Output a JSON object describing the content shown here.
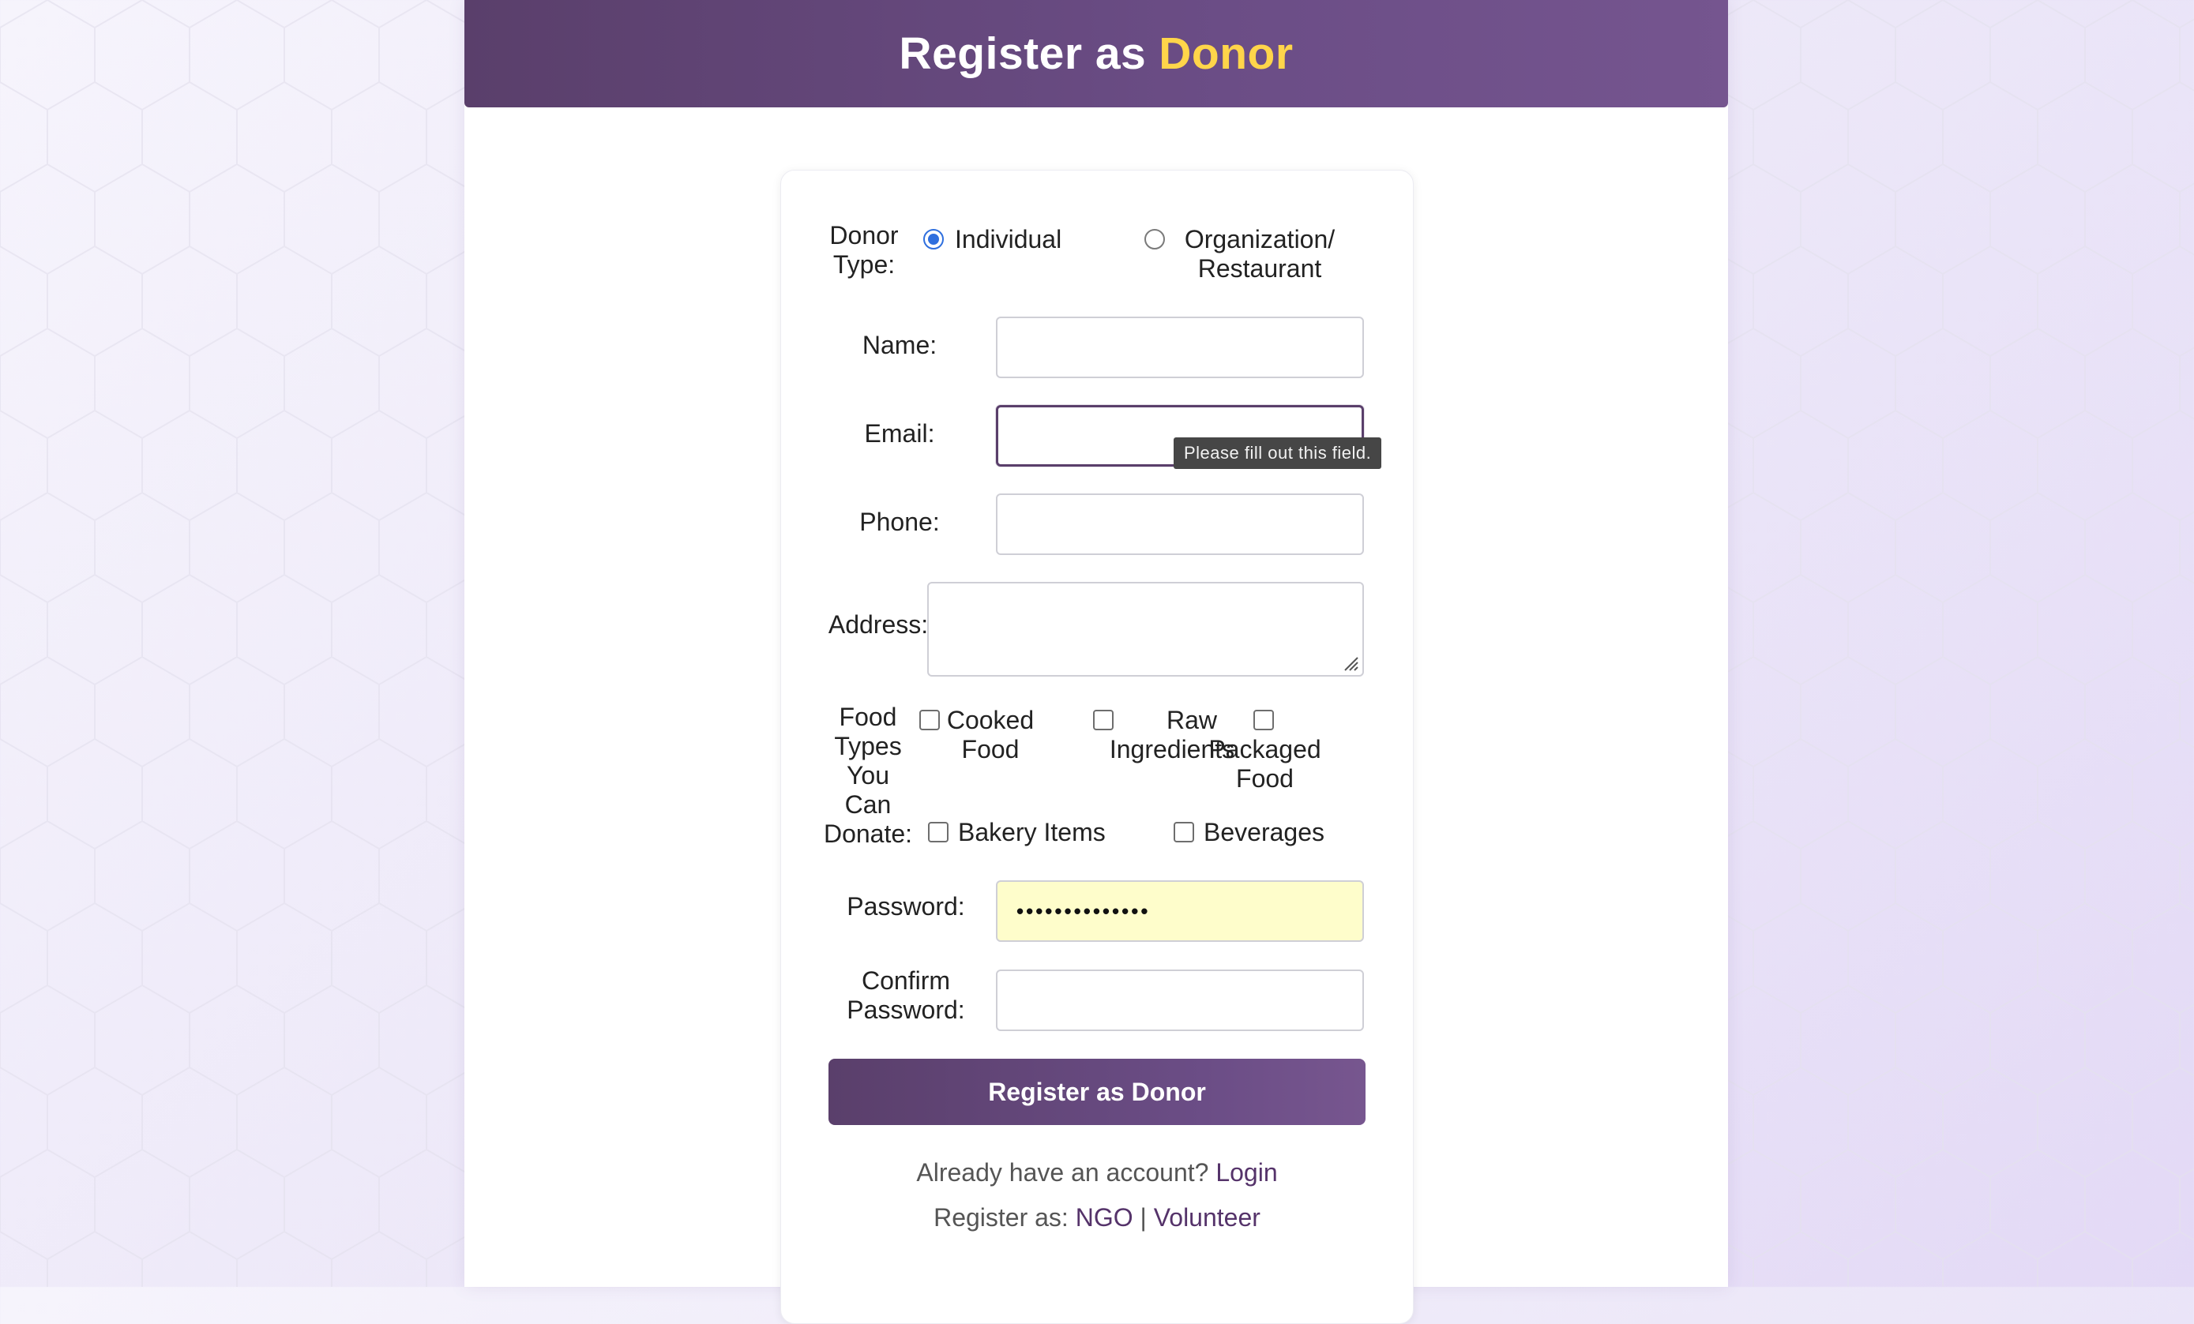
{
  "header": {
    "title_prefix": "Register as",
    "title_accent": "Donor",
    "accent_color": "#ffd54a",
    "brand_color": "#5a3f6b"
  },
  "form": {
    "donor_type": {
      "label_line1": "Donor",
      "label_line2": "Type:",
      "options": [
        {
          "line1": "Individual",
          "line2": "",
          "checked": true
        },
        {
          "line1": "Organization/",
          "line2": "Restaurant",
          "checked": false
        }
      ]
    },
    "name": {
      "label": "Name:",
      "value": ""
    },
    "email": {
      "label": "Email:",
      "value": "",
      "validation_tooltip": "Please fill out this field."
    },
    "phone": {
      "label": "Phone:",
      "value": ""
    },
    "address": {
      "label": "Address:",
      "value": ""
    },
    "food_types": {
      "label_lines": [
        "Food",
        "Types",
        "You",
        "Can",
        "Donate:"
      ],
      "options": [
        {
          "line1": "Cooked",
          "line2": "Food",
          "checked": false
        },
        {
          "line1": "Raw",
          "line2": "Ingredients",
          "checked": false
        },
        {
          "line1": "",
          "line2": "Packaged",
          "line3": "Food",
          "checked": false
        },
        {
          "line1": "Bakery Items",
          "checked": false
        },
        {
          "line1": "Beverages",
          "checked": false
        }
      ]
    },
    "password": {
      "label": "Password:",
      "masked_value": "••••••••••••••"
    },
    "confirm_password": {
      "label_line1": "Confirm",
      "label_line2": "Password:",
      "value": ""
    },
    "submit_label": "Register as Donor"
  },
  "footer": {
    "account_prompt": "Already have an account?",
    "login_link": "Login",
    "register_prompt": "Register as:",
    "ngo_link": "NGO",
    "separator": "|",
    "volunteer_link": "Volunteer"
  }
}
